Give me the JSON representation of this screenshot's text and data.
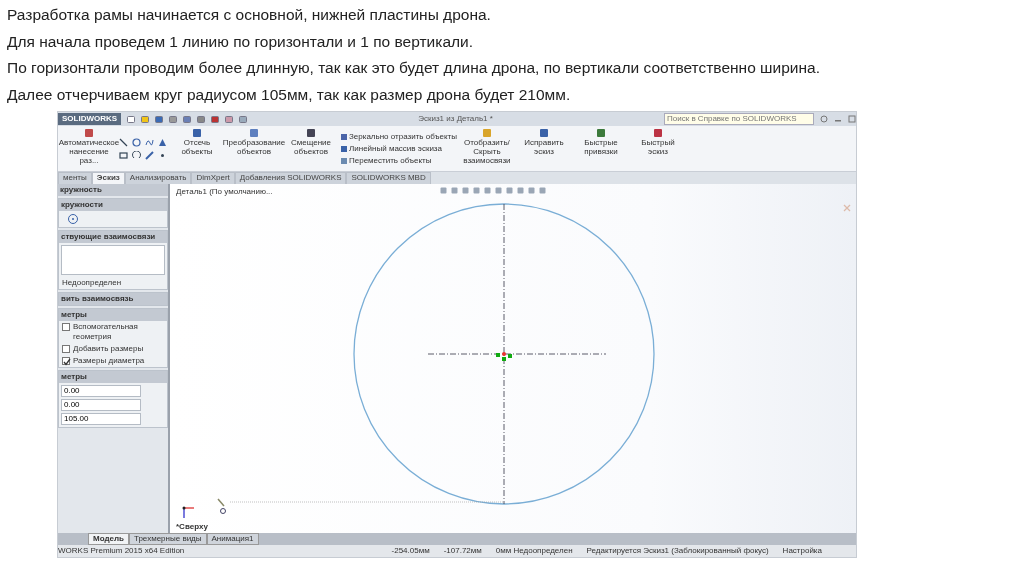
{
  "slide": {
    "lines": [
      "Разработка рамы начинается с основной, нижней пластины дрона.",
      "Для начала проведем 1 линию по горизонтали и 1 по вертикали.",
      "По горизонтали проводим более длинную, так как это будет длина дрона, по вертикали соответственно ширина.",
      "Далее отчерчиваем круг радиусом 105мм, так как размер дрона будет 210мм."
    ]
  },
  "app": {
    "logo": "SOLIDWORKS",
    "title": "Эскиз1 из Деталь1 *",
    "search": {
      "placeholder": "Поиск в Справке по SOLIDWORKS"
    },
    "ribbon": [
      {
        "kind": "big",
        "label": "Автоматическое нанесение раз..."
      },
      {
        "kind": "tools"
      },
      {
        "kind": "big",
        "label": "Отсечь объекты"
      },
      {
        "kind": "big",
        "label": "Преобразование объектов"
      },
      {
        "kind": "big",
        "label": "Смещение объектов"
      },
      {
        "kind": "list",
        "items": [
          "Зеркально отразить объекты",
          "Линейный массив эскиза",
          "Переместить объекты"
        ]
      },
      {
        "kind": "big",
        "label": "Отобразить/Скрыть взаимосвязи"
      },
      {
        "kind": "big",
        "label": "Исправить эскиз"
      },
      {
        "kind": "big",
        "label": "Быстрые привязки"
      },
      {
        "kind": "big",
        "label": "Быстрый эскиз"
      }
    ],
    "tabs": [
      {
        "label": "менты",
        "selected": false
      },
      {
        "label": "Эскиз",
        "selected": true
      },
      {
        "label": "Анализировать",
        "selected": false
      },
      {
        "label": "DimXpert",
        "selected": false
      },
      {
        "label": "Добавления SOLIDWORKS",
        "selected": false
      },
      {
        "label": "SOLIDWORKS MBD",
        "selected": false
      }
    ],
    "tree": {
      "label": "Деталь1 (По умолчанию..."
    },
    "panel": {
      "header": "кружность",
      "sections": [
        {
          "kind": "icons",
          "title": "кружности"
        },
        {
          "kind": "list",
          "title": "ствующие взаимосвязи",
          "note": "Недоопределен"
        },
        {
          "kind": "collapsed",
          "title": "вить взаимосвязь"
        },
        {
          "kind": "checks",
          "title": "метры",
          "options": [
            {
              "label": "Вспомогательная геометрия",
              "checked": false
            },
            {
              "label": "Добавить размеры",
              "checked": false
            },
            {
              "label": "Размеры диаметра",
              "checked": true
            }
          ]
        },
        {
          "kind": "fields",
          "title": "метры",
          "fields": [
            "0.00",
            "0.00",
            "105.00"
          ]
        }
      ]
    },
    "view_label": "*Сверху",
    "bottom_tabs": [
      {
        "label": "Модель",
        "selected": true
      },
      {
        "label": "Трехмерные виды",
        "selected": false
      },
      {
        "label": "Анимация1",
        "selected": false
      }
    ],
    "status": {
      "edition": "WORKS Premium 2015 x64 Edition",
      "items": [
        "-254.05мм",
        "-107.72мм",
        "0мм Недоопределен",
        "Редактируется Эскиз1 (Заблокированный фокус)",
        "Настройка"
      ]
    }
  }
}
